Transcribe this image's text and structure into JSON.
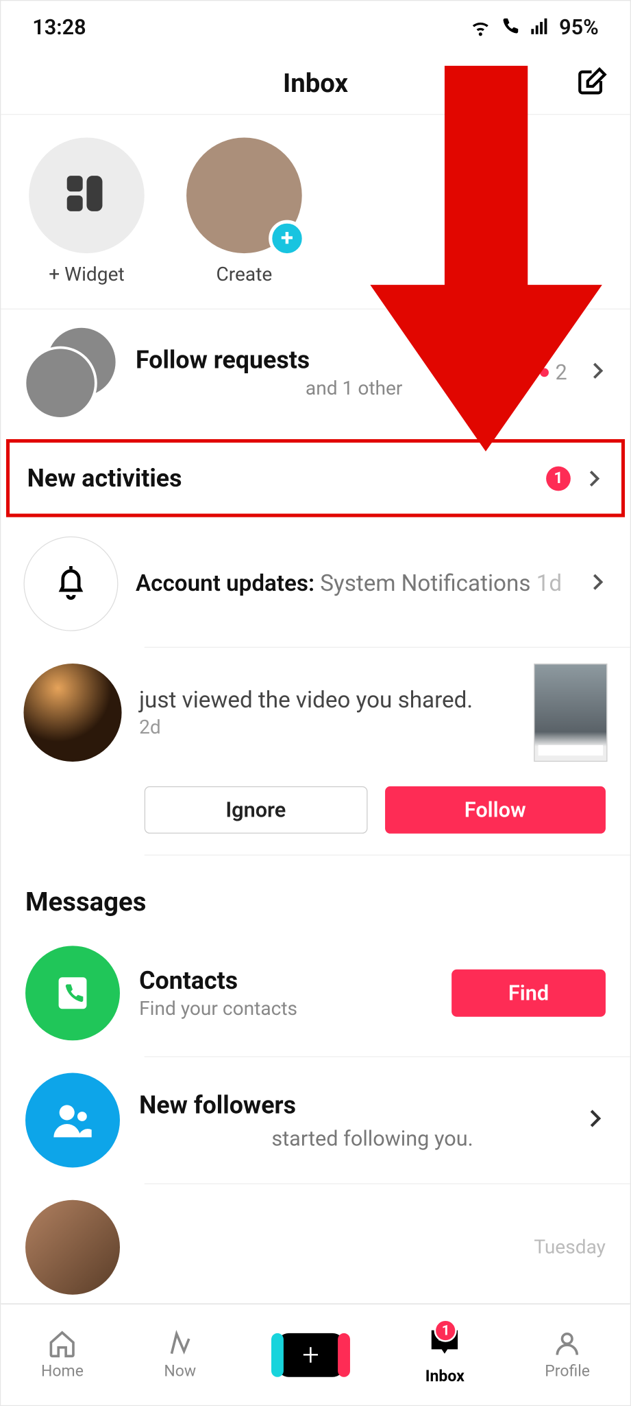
{
  "status": {
    "time": "13:28",
    "battery": "95%"
  },
  "header": {
    "title": "Inbox"
  },
  "shortcuts": {
    "widget_label": "+ Widget",
    "create_label": "Create"
  },
  "follow_requests": {
    "title": "Follow requests",
    "subtitle": "and 1 other",
    "count": "2"
  },
  "new_activities": {
    "title": "New activities",
    "badge": "1"
  },
  "account_updates": {
    "bold": "Account updates:",
    "tail": " System Notifications ",
    "time": "1d"
  },
  "viewed": {
    "text": "just viewed the video you shared.",
    "time": "2d",
    "ignore": "Ignore",
    "follow": "Follow"
  },
  "messages": {
    "section_title": "Messages",
    "contacts_title": "Contacts",
    "contacts_sub": "Find your contacts",
    "find_label": "Find",
    "followers_title": "New followers",
    "followers_sub": "started following you.",
    "tuesday": "Tuesday"
  },
  "nav": {
    "home": "Home",
    "now": "Now",
    "inbox": "Inbox",
    "profile": "Profile",
    "inbox_badge": "1"
  }
}
